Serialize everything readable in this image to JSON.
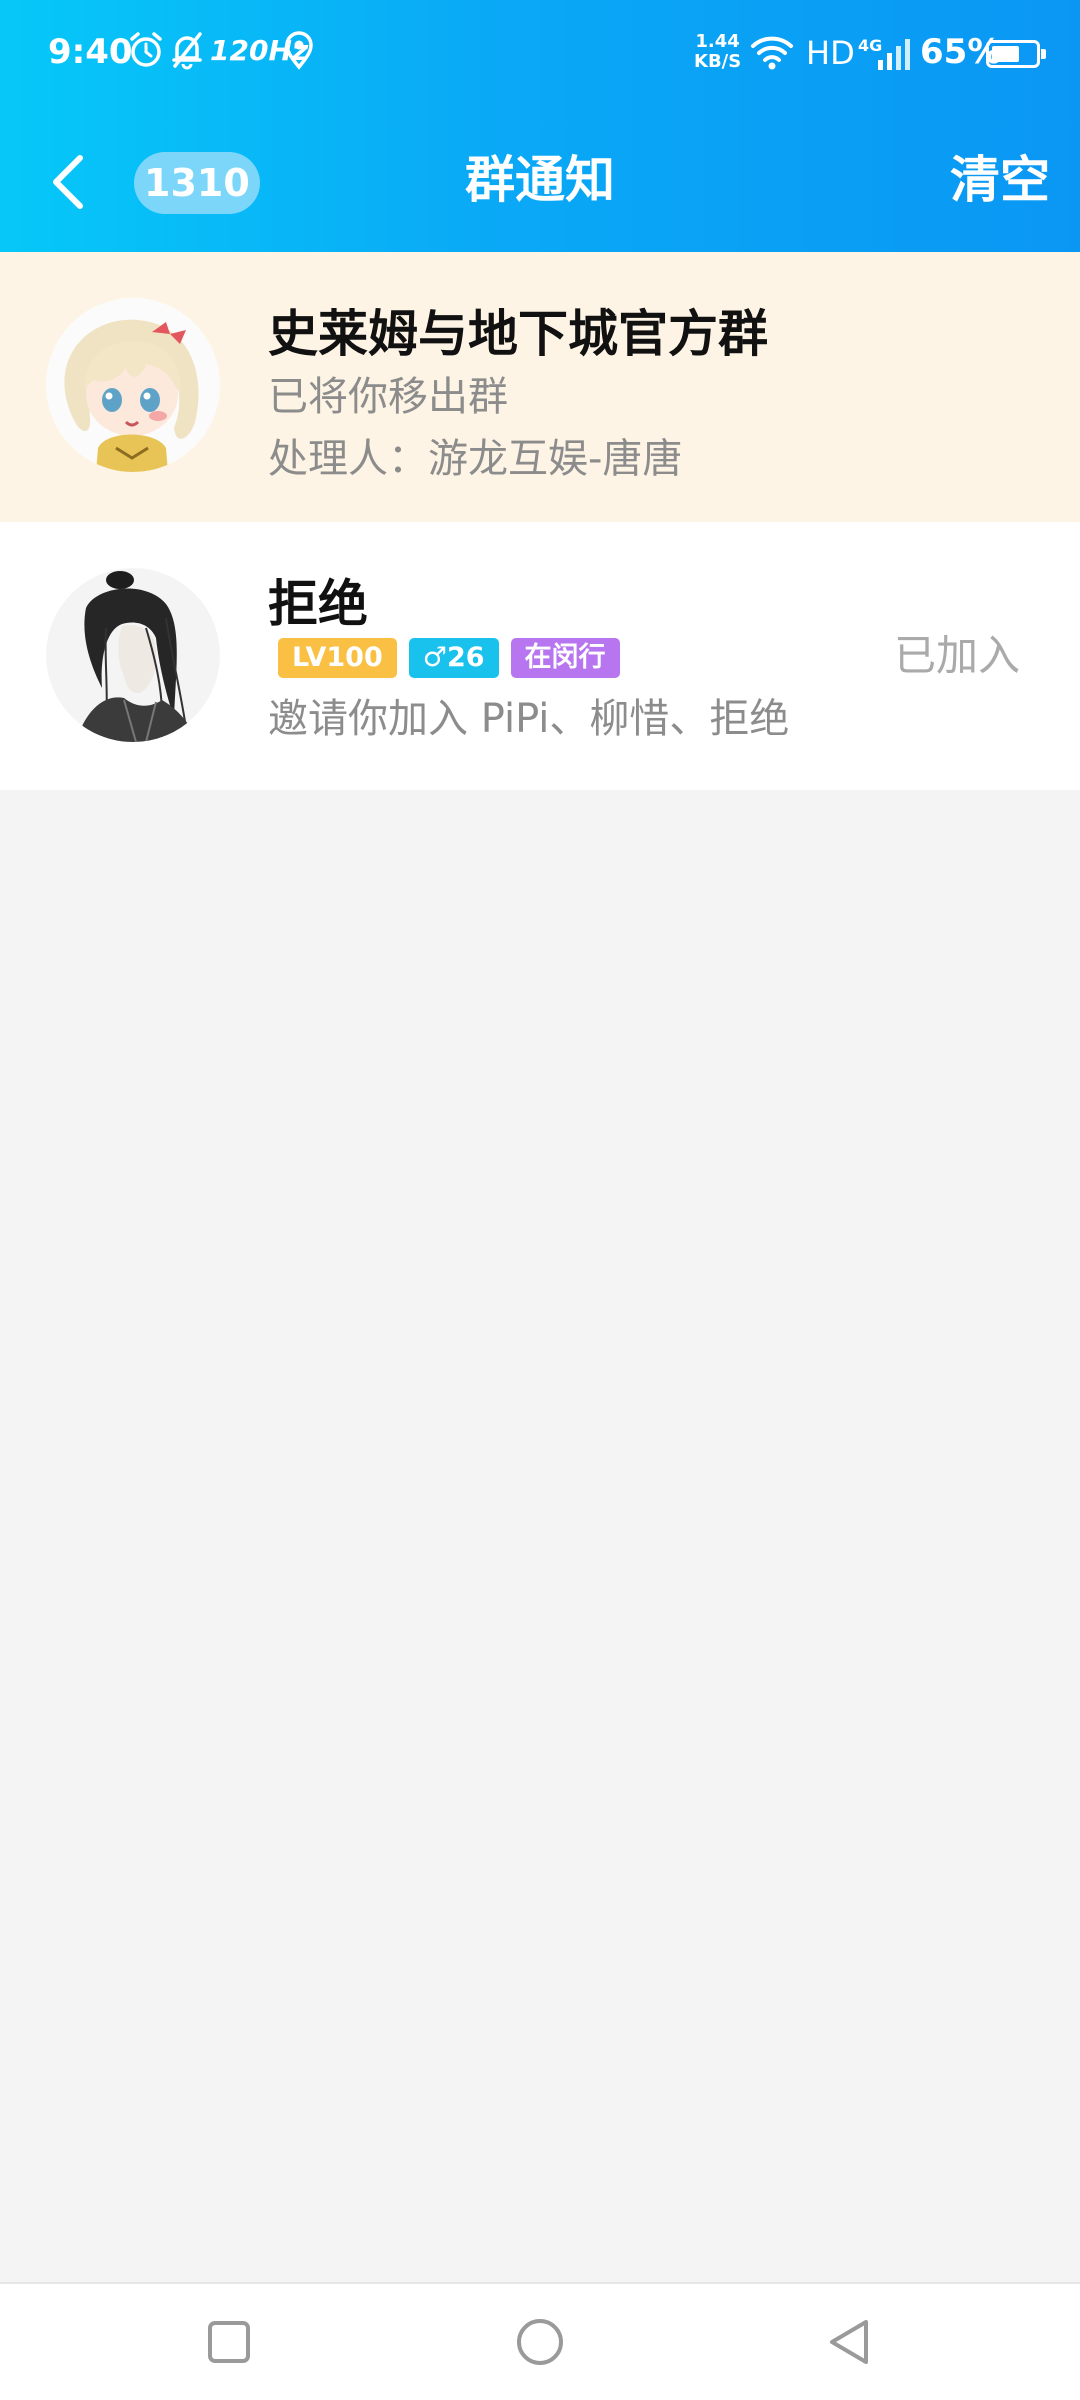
{
  "status_bar": {
    "time": "9:40",
    "refresh_rate": "120Hz",
    "net_speed_value": "1.44",
    "net_speed_unit": "KB/S",
    "hd": "HD",
    "network": "4G",
    "battery_pct": "65%",
    "battery_level": 0.65
  },
  "header": {
    "unread_count": "1310",
    "title": "群通知",
    "clear_label": "清空"
  },
  "notifications": [
    {
      "name": "史莱姆与地下城官方群",
      "line1": "已将你移出群",
      "line2": "处理人：游龙互娱-唐唐"
    },
    {
      "name": "拒绝",
      "tags": [
        {
          "text": "LV100",
          "color": "#f9c043"
        },
        {
          "text": "♂26",
          "color": "#18c2ec"
        },
        {
          "text": "在闵行",
          "color": "#b775f0"
        }
      ],
      "line1": "邀请你加入 PiPi、柳惜、拒绝",
      "status": "已加入"
    }
  ],
  "colors": {
    "header_gradient_start": "#06c8f8",
    "header_gradient_end": "#0a97f4",
    "highlight_row": "#fdf4e5",
    "page_bg": "#f4f4f4"
  }
}
